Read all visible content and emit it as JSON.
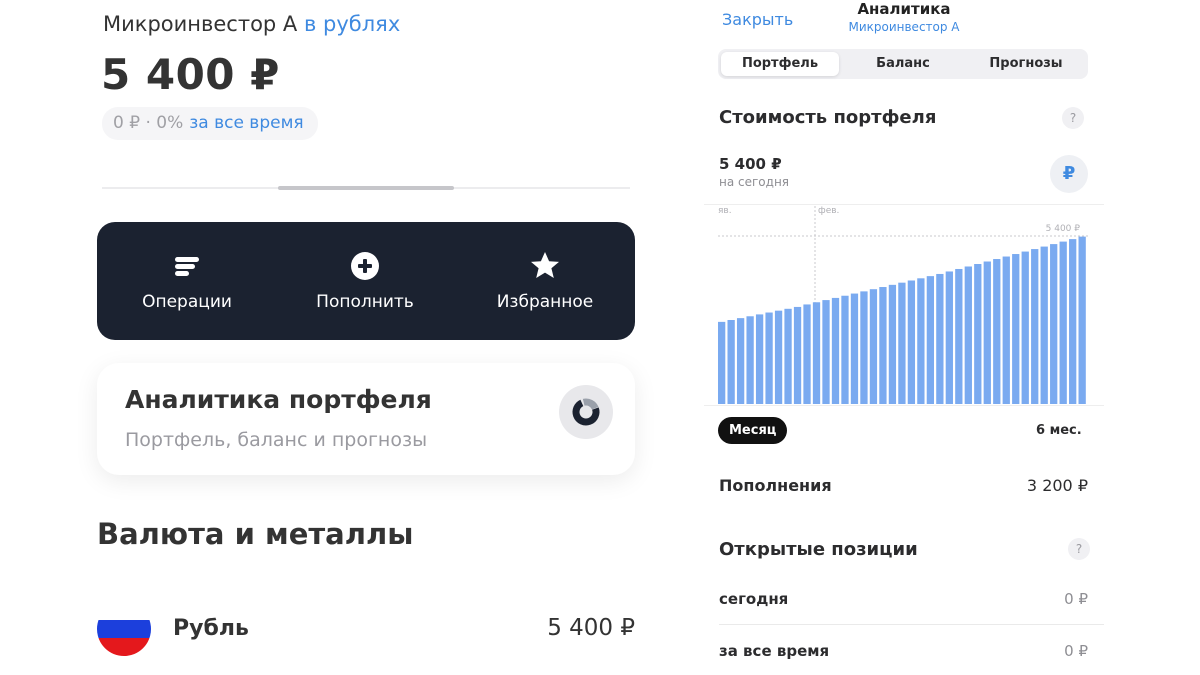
{
  "portfolio": {
    "account_name": "Микроинвестор А",
    "currency_link": "в рублях",
    "total": "5 400 ₽",
    "change_text": "0 ₽ · 0%",
    "change_period": "за все время"
  },
  "actions": [
    {
      "label": "Операции",
      "icon": "operations-icon"
    },
    {
      "label": "Пополнить",
      "icon": "plus-circle-icon"
    },
    {
      "label": "Избранное",
      "icon": "star-icon"
    }
  ],
  "analytics_card": {
    "title": "Аналитика портфеля",
    "subtitle": "Портфель, баланс и прогнозы",
    "icon": "donut-chart-icon"
  },
  "section": {
    "title": "Валюта и металлы"
  },
  "currencies": [
    {
      "name": "Рубль",
      "amount": "5 400 ₽",
      "icon": "russia-flag-icon",
      "colors": [
        "#ffffff",
        "#1c3fdc",
        "#e4181c"
      ]
    }
  ],
  "analytics_panel": {
    "close_label": "Закрыть",
    "title": "Аналитика",
    "subtitle": "Микроинвестор А",
    "tabs": [
      "Портфель",
      "Баланс",
      "Прогнозы"
    ],
    "active_tab": 0,
    "portfolio_title": "Стоимость портфеля",
    "help_symbol": "?",
    "value": "5 400 ₽",
    "value_date": "на сегодня",
    "currency_symbol": "₽",
    "periods": [
      "Месяц",
      "6 мес."
    ],
    "active_period": 0,
    "deposits_label": "Пополнения",
    "deposits_value": "3 200 ₽",
    "open_positions_title": "Открытые позиции",
    "positions": [
      {
        "label": "сегодня",
        "value": "0 ₽"
      },
      {
        "label": "за все время",
        "value": "0 ₽"
      }
    ]
  },
  "chart_data": {
    "type": "bar",
    "x_ticks": [
      "яв.",
      "фев."
    ],
    "max_label": "5 400 ₽",
    "ylim": [
      0,
      5400
    ],
    "values": [
      2640,
      2700,
      2760,
      2820,
      2880,
      2940,
      3000,
      3060,
      3120,
      3200,
      3270,
      3340,
      3410,
      3480,
      3550,
      3620,
      3690,
      3760,
      3830,
      3900,
      3970,
      4040,
      4110,
      4180,
      4260,
      4340,
      4420,
      4500,
      4580,
      4660,
      4740,
      4820,
      4900,
      4980,
      5060,
      5140,
      5220,
      5300,
      5380
    ],
    "bar_color": "#7aaaf0"
  },
  "colors": {
    "accent": "#3f8ae0",
    "action_card_bg": "#1b2230"
  }
}
